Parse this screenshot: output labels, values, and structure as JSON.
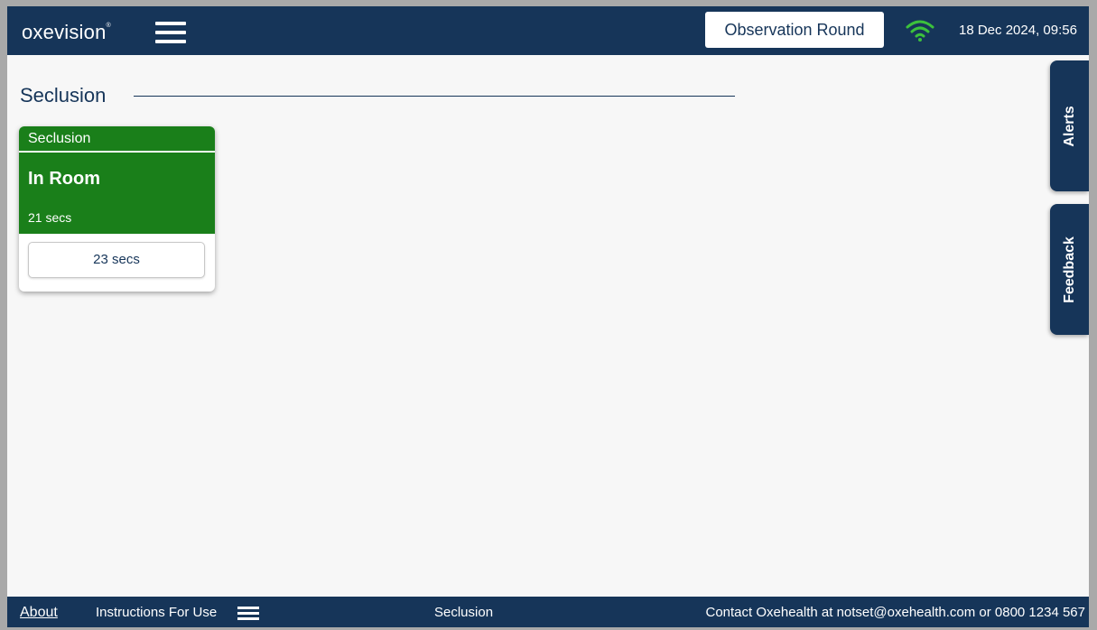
{
  "header": {
    "logo_text": "oxevision",
    "logo_mark": "®",
    "observation_button": "Observation Round",
    "datetime": "18 Dec 2024, 09:56",
    "wifi_color": "#3cc13c"
  },
  "section": {
    "title": "Seclusion"
  },
  "card": {
    "header": "Seclusion",
    "status": "In Room",
    "elapsed": "21 secs",
    "timer": "23 secs",
    "status_color": "#1a7f1a"
  },
  "side_tabs": {
    "alerts": "Alerts",
    "feedback": "Feedback"
  },
  "footer": {
    "about": "About",
    "instructions": "Instructions For Use",
    "center": "Seclusion",
    "contact": "Contact Oxehealth at notset@oxehealth.com or 0800 1234 567"
  },
  "colors": {
    "navy": "#163559",
    "background": "#f7f7f7"
  }
}
